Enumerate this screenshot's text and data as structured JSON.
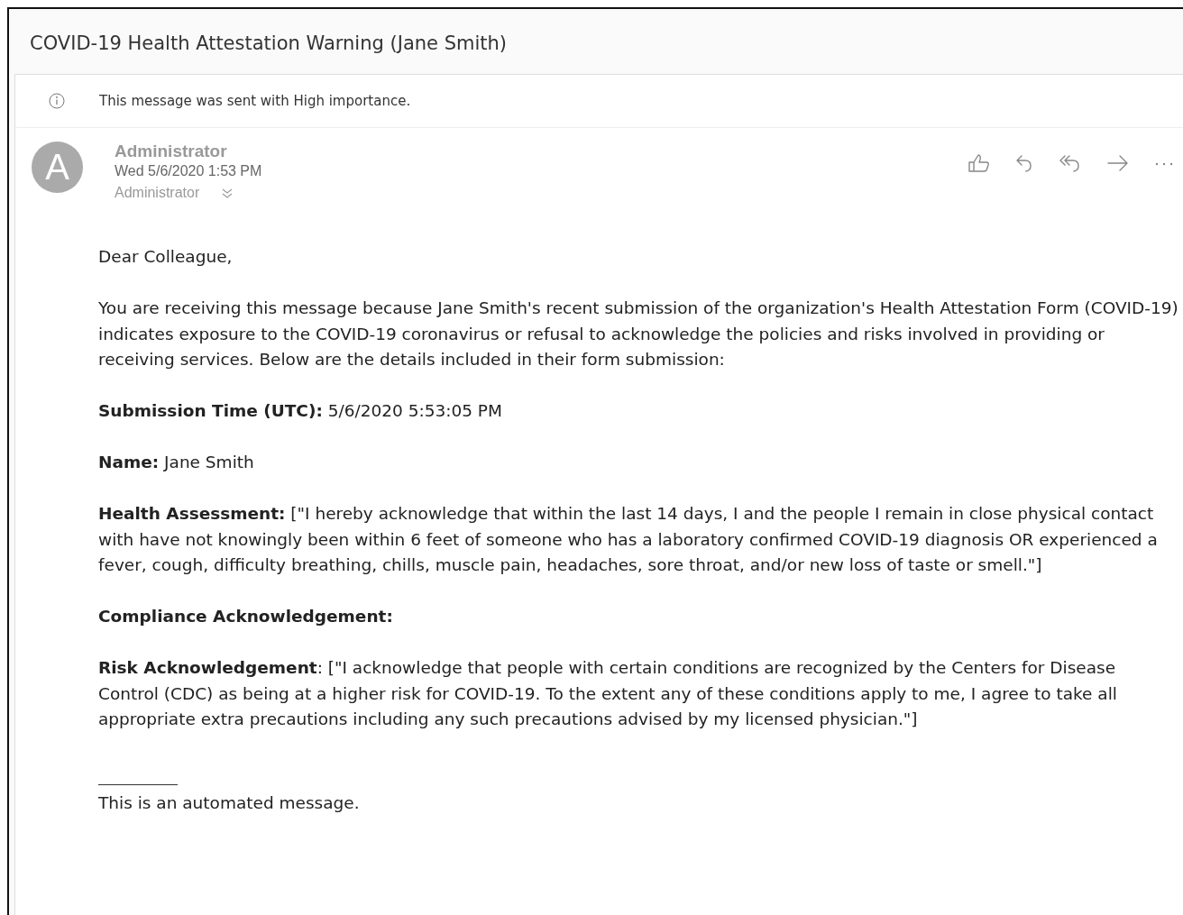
{
  "message": {
    "subject": "COVID-19 Health Attestation Warning (Jane Smith)",
    "importance_notice": "This message was sent with High importance.",
    "sender": {
      "avatar_letter": "A",
      "name": "Administrator",
      "date": "Wed 5/6/2020 1:53 PM",
      "to": "Administrator"
    },
    "body": [
      "Dear Colleague,",
      "You are receiving this message because Jane Smith's recent submission of the organization's Health Attestation Form (COVID-19) indicates exposure to the COVID-19 coronavirus or refusal to acknowledge the policies and risks involved in providing or receiving services. Below are the details included in their form submission:",
      "**Submission Time (UTC):** 5/6/2020 5:53:05 PM",
      "**Name:** Jane Smith",
      "**Health Assessment:** [\"I hereby acknowledge that within the last 14 days, I and the people I remain in close physical contact with  have not knowingly been within 6 feet of someone who has a laboratory confirmed COVID-19 diagnosis OR experienced a fever, cough, difficulty breathing, chills, muscle pain, headaches, sore throat, and/or new loss of taste or smell.\"]",
      "**Compliance Acknowledgement:**",
      "**Risk Acknowledgement**: [\"I acknowledge that people with certain conditions are recognized by the Centers for Disease Control (CDC) as being at a higher risk for COVID-19. To the extent any of these conditions apply to me, I agree to take all appropriate extra precautions including any such precautions advised by my licensed physician.\"]"
    ],
    "footer": "This is an automated message."
  }
}
